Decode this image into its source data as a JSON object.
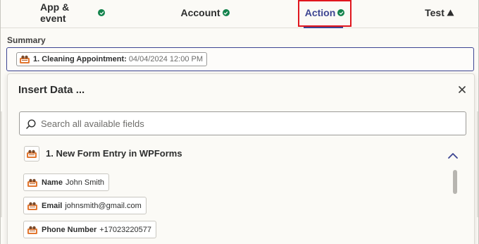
{
  "tabs": [
    {
      "label": "App & event",
      "status": "complete"
    },
    {
      "label": "Account",
      "status": "complete"
    },
    {
      "label": "Action",
      "status": "complete",
      "active": true
    },
    {
      "label": "Test",
      "status": "warning"
    }
  ],
  "summary": {
    "label": "Summary",
    "chip_key": "1. Cleaning Appointment:",
    "chip_value": "04/04/2024 12:00 PM"
  },
  "panel": {
    "title": "Insert Data ...",
    "search_placeholder": "Search all available fields",
    "section_title": "1. New Form Entry in WPForms",
    "fields": [
      {
        "key": "Name",
        "value": "John Smith"
      },
      {
        "key": "Email",
        "value": "johnsmith@gmail.com"
      },
      {
        "key": "Phone Number",
        "value": "+17023220577"
      }
    ]
  },
  "colors": {
    "accent": "#3d4592",
    "success": "#13834c",
    "highlight": "#e0161e"
  },
  "icons": [
    "check-icon",
    "warning-icon",
    "wpforms-logo-icon",
    "close-icon",
    "search-icon",
    "chevron-up-icon"
  ]
}
